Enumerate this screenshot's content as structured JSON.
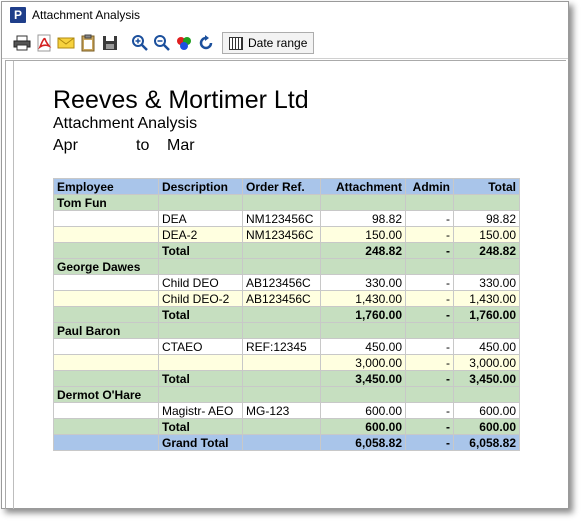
{
  "window": {
    "title": "Attachment Analysis",
    "app_icon_letter": "P"
  },
  "toolbar": {
    "icons": [
      "print-icon",
      "pdf-icon",
      "email-icon",
      "clipboard-icon",
      "save-icon",
      "zoom-in-icon",
      "zoom-out-icon",
      "colors-icon",
      "refresh-icon"
    ],
    "date_range_label": "Date range"
  },
  "report": {
    "company": "Reeves & Mortimer Ltd",
    "title": "Attachment Analysis",
    "period_from": "Apr",
    "period_to_word": "to",
    "period_to": "Mar",
    "headers": [
      "Employee",
      "Description",
      "Order Ref.",
      "Attachment",
      "Admin",
      "Total"
    ],
    "rows": [
      {
        "type": "emp",
        "cells": [
          "Tom Fun",
          "",
          "",
          "",
          "",
          ""
        ]
      },
      {
        "type": "odd",
        "cells": [
          "",
          "DEA",
          "NM123456C",
          "98.82",
          "-",
          "98.82"
        ]
      },
      {
        "type": "even",
        "cells": [
          "",
          "DEA-2",
          "NM123456C",
          "150.00",
          "-",
          "150.00"
        ]
      },
      {
        "type": "tot",
        "cells": [
          "",
          "Total",
          "",
          "248.82",
          "-",
          "248.82"
        ]
      },
      {
        "type": "emp",
        "cells": [
          "George Dawes",
          "",
          "",
          "",
          "",
          ""
        ]
      },
      {
        "type": "odd",
        "cells": [
          "",
          "Child DEO",
          "AB123456C",
          "330.00",
          "-",
          "330.00"
        ]
      },
      {
        "type": "even",
        "cells": [
          "",
          "Child DEO-2",
          "AB123456C",
          "1,430.00",
          "-",
          "1,430.00"
        ]
      },
      {
        "type": "tot",
        "cells": [
          "",
          "Total",
          "",
          "1,760.00",
          "-",
          "1,760.00"
        ]
      },
      {
        "type": "emp",
        "cells": [
          "Paul Baron",
          "",
          "",
          "",
          "",
          ""
        ]
      },
      {
        "type": "odd",
        "cells": [
          "",
          "CTAEO",
          "REF:12345",
          "450.00",
          "-",
          "450.00"
        ]
      },
      {
        "type": "even",
        "cells": [
          "",
          "",
          "",
          "3,000.00",
          "-",
          "3,000.00"
        ]
      },
      {
        "type": "tot",
        "cells": [
          "",
          "Total",
          "",
          "3,450.00",
          "-",
          "3,450.00"
        ]
      },
      {
        "type": "emp",
        "cells": [
          "Dermot O'Hare",
          "",
          "",
          "",
          "",
          ""
        ]
      },
      {
        "type": "odd",
        "cells": [
          "",
          "Magistr- AEO",
          "MG-123",
          "600.00",
          "-",
          "600.00"
        ]
      },
      {
        "type": "tot",
        "cells": [
          "",
          "Total",
          "",
          "600.00",
          "-",
          "600.00"
        ]
      },
      {
        "type": "gt",
        "cells": [
          "",
          "Grand Total",
          "",
          "6,058.82",
          "-",
          "6,058.82"
        ]
      }
    ]
  }
}
